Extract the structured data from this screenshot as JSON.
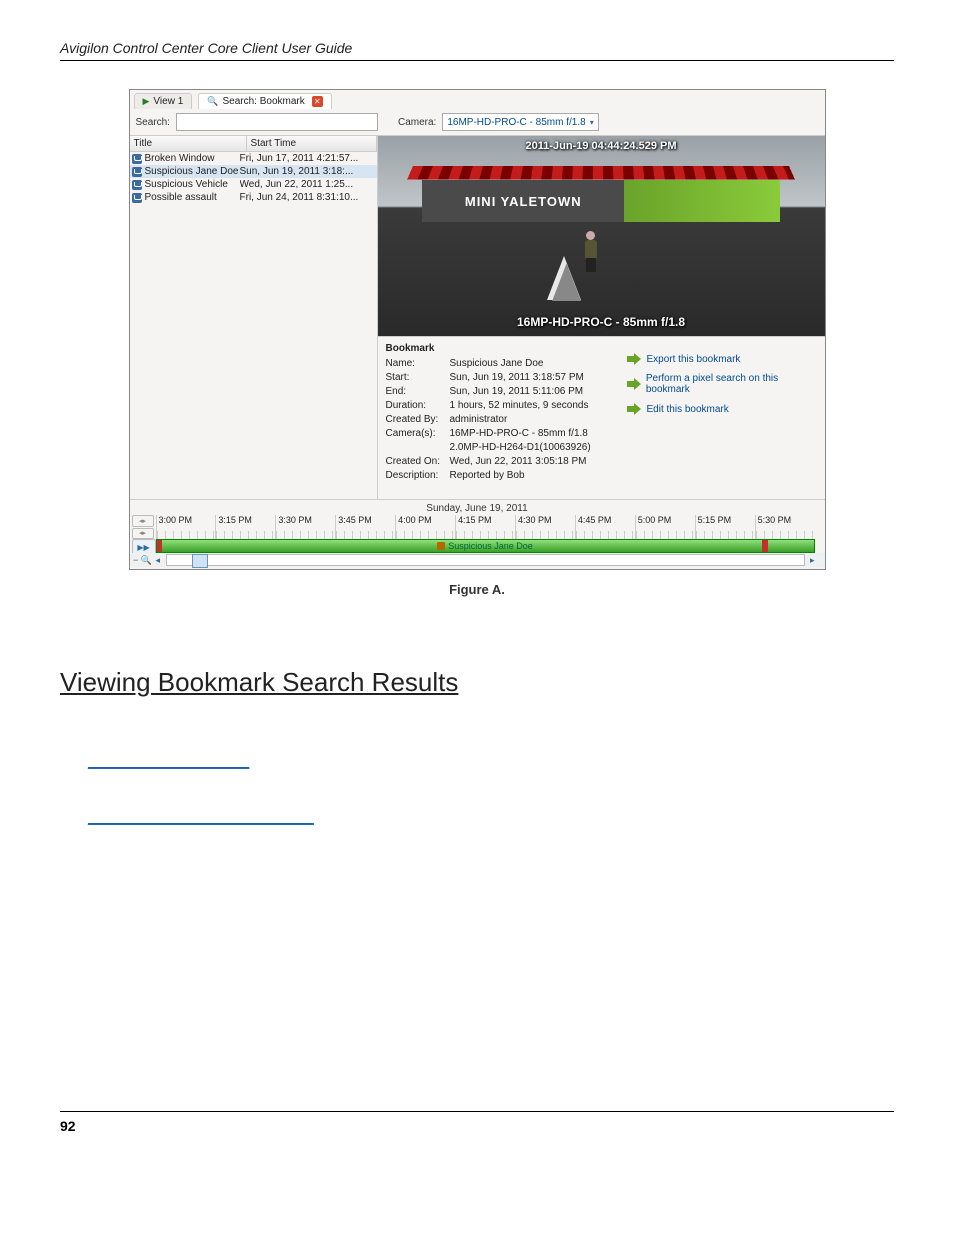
{
  "header": {
    "title": "Avigilon Control Center Core Client User Guide"
  },
  "tabs": {
    "view": "View 1",
    "search": "Search: Bookmark"
  },
  "searchRow": {
    "searchLabel": "Search:",
    "cameraLabel": "Camera:",
    "cameraValue": "16MP-HD-PRO-C - 85mm f/1.8"
  },
  "listHeader": {
    "title": "Title",
    "start": "Start Time"
  },
  "bookmarks": [
    {
      "title": "Broken Window",
      "start": "Fri, Jun 17, 2011 4:21:57..."
    },
    {
      "title": "Suspicious Jane Doe",
      "start": "Sun, Jun 19, 2011 3:18:..."
    },
    {
      "title": "Suspicious Vehicle",
      "start": "Wed, Jun 22, 2011 1:25..."
    },
    {
      "title": "Possible assault",
      "start": "Fri, Jun 24, 2011 8:31:10..."
    }
  ],
  "video": {
    "timestamp": "2011-Jun-19 04:44:24.529 PM",
    "storeSign": "MINI YALETOWN",
    "cameraOverlay": "16MP-HD-PRO-C - 85mm f/1.8"
  },
  "detail": {
    "heading": "Bookmark",
    "name_k": "Name:",
    "name_v": "Suspicious Jane Doe",
    "start_k": "Start:",
    "start_v": "Sun, Jun 19, 2011 3:18:57 PM",
    "end_k": "End:",
    "end_v": "Sun, Jun 19, 2011 5:11:06 PM",
    "dur_k": "Duration:",
    "dur_v": "1 hours, 52 minutes, 9 seconds",
    "cb_k": "Created By:",
    "cb_v": "administrator",
    "cam_k": "Camera(s):",
    "cam_v1": "16MP-HD-PRO-C - 85mm f/1.8",
    "cam_v2": "2.0MP-HD-H264-D1(10063926)",
    "co_k": "Created On:",
    "co_v": "Wed, Jun 22, 2011 3:05:18 PM",
    "desc_k": "Description:",
    "desc_v": "Reported by Bob"
  },
  "actions": {
    "export": "Export this bookmark",
    "pixel": "Perform a pixel search on this bookmark",
    "edit": "Edit this bookmark"
  },
  "timeline": {
    "date": "Sunday, June 19, 2011",
    "ticks": [
      "3:00 PM",
      "3:15 PM",
      "3:30 PM",
      "3:45 PM",
      "4:00 PM",
      "4:15 PM",
      "4:30 PM",
      "4:45 PM",
      "5:00 PM",
      "5:15 PM",
      "5:30 PM"
    ],
    "barLabel": "Suspicious Jane Doe"
  },
  "figure": {
    "label": "Figure A."
  },
  "section": {
    "heading": "Viewing Bookmark Search Results"
  },
  "links": {
    "link1": "____________________",
    "link2": "____________________________"
  },
  "footer": {
    "page": "92"
  }
}
